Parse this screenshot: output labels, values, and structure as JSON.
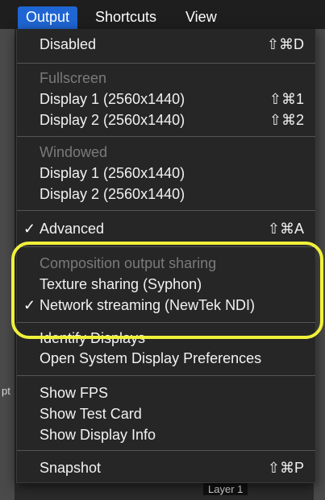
{
  "menubar": {
    "output_label": "Output",
    "shortcuts_label": "Shortcuts",
    "view_label": "View"
  },
  "menu": {
    "disabled": {
      "label": "Disabled",
      "shortcut": "⇧⌘D"
    },
    "fullscreen_header": "Fullscreen",
    "fullscreen_display1": {
      "label": "Display 1 (2560x1440)",
      "shortcut": "⇧⌘1"
    },
    "fullscreen_display2": {
      "label": "Display 2 (2560x1440)",
      "shortcut": "⇧⌘2"
    },
    "windowed_header": "Windowed",
    "windowed_display1": "Display 1 (2560x1440)",
    "windowed_display2": "Display 2 (2560x1440)",
    "advanced": {
      "label": "Advanced",
      "shortcut": "⇧⌘A",
      "checked": true
    },
    "sharing_header": "Composition output sharing",
    "texture_sharing": "Texture sharing (Syphon)",
    "network_streaming": {
      "label": "Network streaming (NewTek NDI)",
      "checked": true
    },
    "identify_displays": "Identify Displays",
    "open_system_prefs": "Open System Display Preferences",
    "show_fps": "Show FPS",
    "show_test_card": "Show Test Card",
    "show_display_info": "Show Display Info",
    "snapshot": {
      "label": "Snapshot",
      "shortcut": "⇧⌘P"
    },
    "checkmark": "✓"
  },
  "background": {
    "left_edge_text": "pt",
    "layer_label": "Layer 1"
  },
  "colors": {
    "menu_bg": "#262626",
    "active_menu": "#1f66d4",
    "highlight": "#f0f03c"
  }
}
